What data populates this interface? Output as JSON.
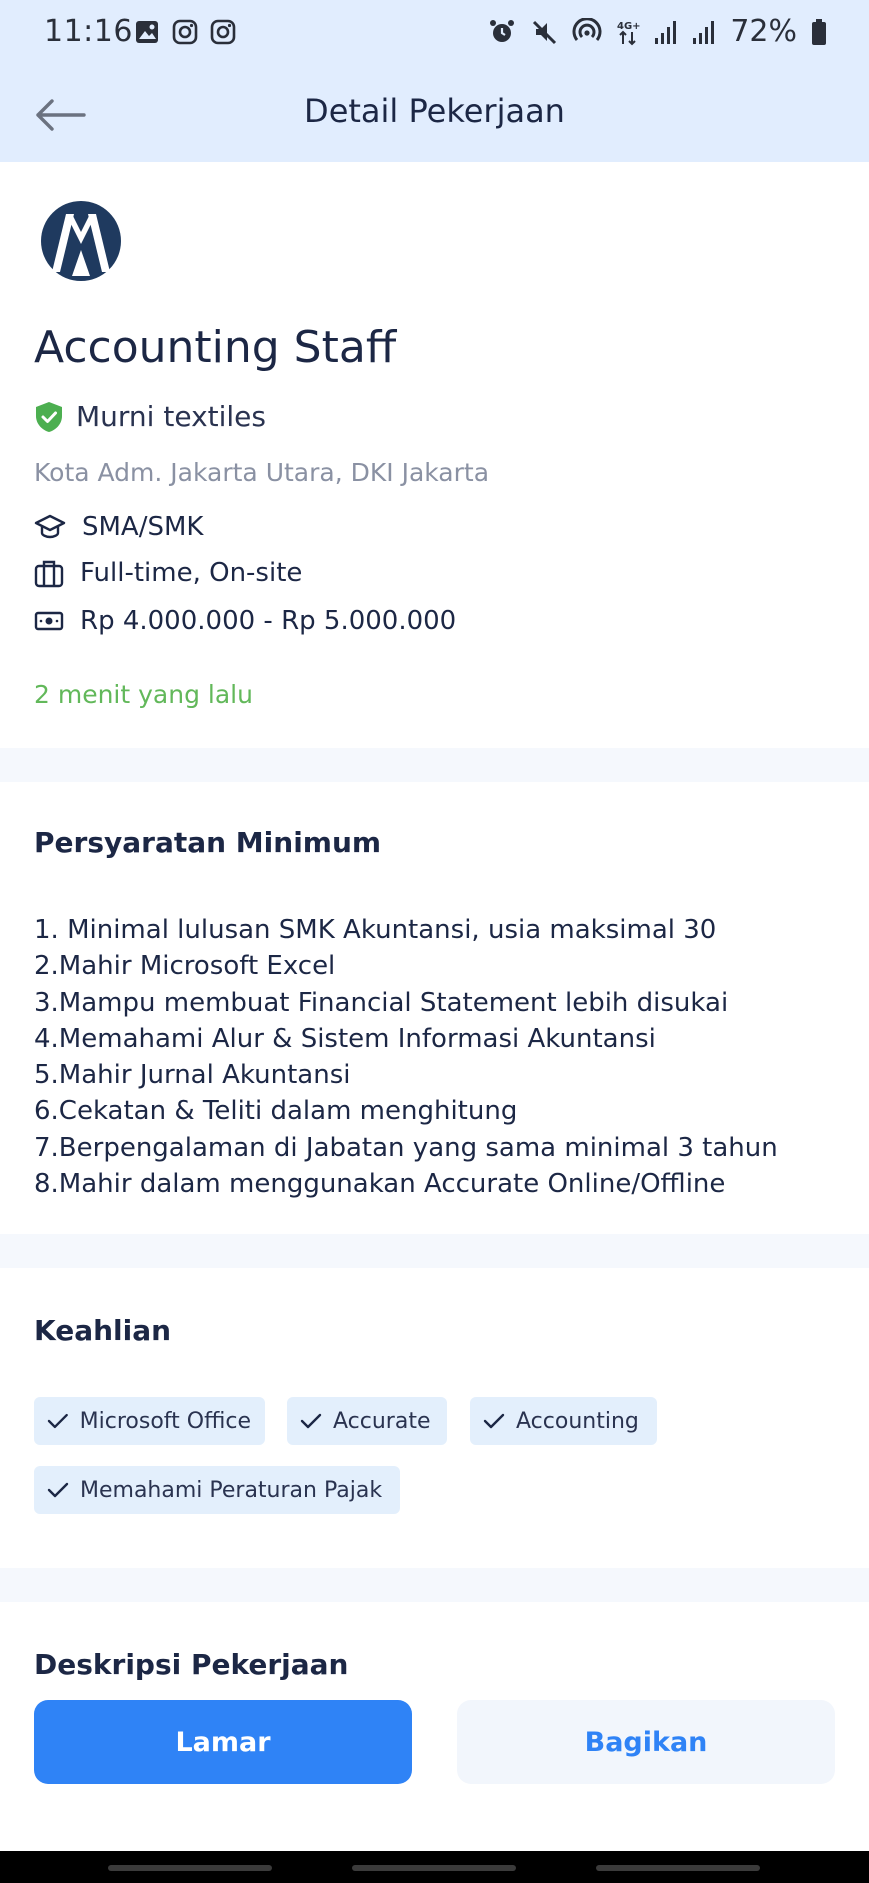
{
  "status_bar": {
    "time": "11:16",
    "battery_percent": "72%",
    "left_icons": [
      "image-icon",
      "instagram-icon",
      "instagram-icon"
    ],
    "right_icons": [
      "alarm-icon",
      "mute-icon",
      "hotspot-icon",
      "4g-icon",
      "signal-icon",
      "signal-icon",
      "battery-icon"
    ]
  },
  "app_bar": {
    "title": "Detail Pekerjaan",
    "back_icon": "arrow-left-icon"
  },
  "job": {
    "title": "Accounting Staff",
    "company": "Murni textiles",
    "verified": true,
    "location": "Kota Adm. Jakarta Utara, DKI Jakarta",
    "education": "SMA/SMK",
    "employment_type": "Full-time, On-site",
    "salary": "Rp 4.000.000 - Rp 5.000.000",
    "posted": "2 menit yang lalu"
  },
  "requirements": {
    "title": "Persyaratan Minimum",
    "items": [
      "1. Minimal lulusan SMK Akuntansi, usia maksimal 30",
      "2.Mahir Microsoft Excel",
      "3.Mampu membuat Financial Statement lebih disukai",
      "4.Memahami Alur & Sistem Informasi Akuntansi",
      "5.Mahir Jurnal Akuntansi",
      "6.Cekatan & Teliti dalam menghitung",
      "7.Berpengalaman di Jabatan yang sama minimal 3 tahun",
      "8.Mahir dalam menggunakan Accurate Online/Offline"
    ]
  },
  "skills": {
    "title": "Keahlian",
    "items": [
      "Microsoft Office",
      "Accurate",
      "Accounting",
      "Memahami Peraturan Pajak"
    ]
  },
  "description": {
    "title": "Deskripsi Pekerjaan"
  },
  "actions": {
    "apply_label": "Lamar",
    "share_label": "Bagikan"
  },
  "colors": {
    "header_bg": "#e1edfe",
    "primary": "#2f83f6",
    "posted_green": "#62b85a",
    "verified_green": "#4caf50",
    "chip_bg": "#e3effc"
  }
}
